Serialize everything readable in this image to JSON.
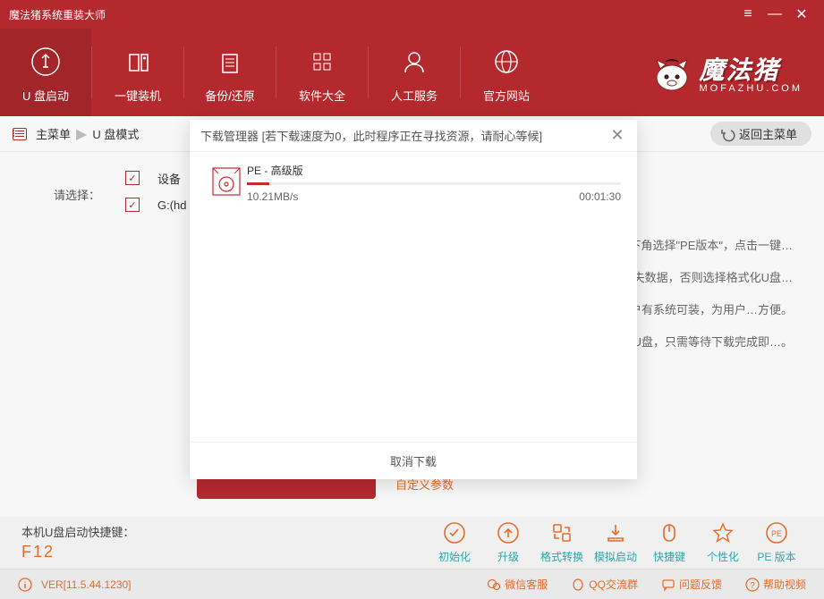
{
  "title": "魔法猪系统重装大师",
  "toolbar": {
    "items": [
      {
        "label": "U 盘启动"
      },
      {
        "label": "一键装机"
      },
      {
        "label": "备份/还原"
      },
      {
        "label": "软件大全"
      },
      {
        "label": "人工服务"
      },
      {
        "label": "官方网站"
      }
    ]
  },
  "brand": {
    "name": "魔法猪",
    "sub": "MOFAZHU.COM"
  },
  "breadcrumb": {
    "root": "主菜单",
    "current": "U 盘模式",
    "back_label": "返回主菜单"
  },
  "content": {
    "select_label": "请选择：",
    "rows": [
      {
        "label": "设备"
      },
      {
        "label": "G:(hd"
      }
    ],
    "paragraphs": [
      "…下角选择\"PE版本\"，点击一键…",
      "…式，如果用户想保存U盘数据，就…丢失数据，否则选择格式化U盘…",
      "…重装大师\"提供系统下载，为用户…，保证用户有系统可装，为用户…方便。",
      "…重装大师\"将全程自动为用户提供…下载至U盘，只需等待下载完成即…。"
    ],
    "custom_params": "自定义参数"
  },
  "actions": {
    "hotkey_label": "本机U盘启动快捷键：",
    "hotkey": "F12",
    "items": [
      {
        "label": "初始化"
      },
      {
        "label": "升级"
      },
      {
        "label": "格式转换"
      },
      {
        "label": "模拟启动"
      },
      {
        "label": "快捷键"
      },
      {
        "label": "个性化"
      },
      {
        "label": "PE 版本"
      }
    ]
  },
  "footer": {
    "version": "VER[11.5.44.1230]",
    "items": [
      {
        "label": "微信客服"
      },
      {
        "label": "QQ交流群"
      },
      {
        "label": "问题反馈"
      },
      {
        "label": "帮助视频"
      }
    ]
  },
  "modal": {
    "title": "下载管理器 [若下载速度为0，此时程序正在寻找资源，请耐心等候]",
    "item_name": "PE - 高级版",
    "speed": "10.21MB/s",
    "eta": "00:01:30",
    "cancel": "取消下载"
  }
}
